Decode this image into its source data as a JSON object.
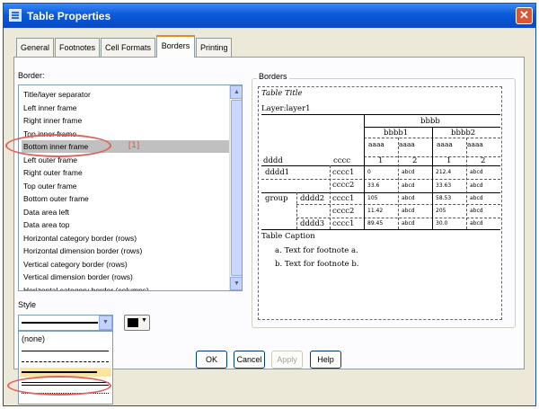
{
  "window": {
    "title": "Table Properties",
    "close_glyph": "✕"
  },
  "tabs": [
    {
      "label": "General",
      "active": false
    },
    {
      "label": "Footnotes",
      "active": false
    },
    {
      "label": "Cell Formats",
      "active": false
    },
    {
      "label": "Borders",
      "active": true
    },
    {
      "label": "Printing",
      "active": false
    }
  ],
  "border_section": {
    "label": "Border:",
    "items": [
      "Title/layer separator",
      "Left inner frame",
      "Right inner frame",
      "Top inner frame",
      "Bottom inner frame",
      "Left outer frame",
      "Right outer frame",
      "Top outer frame",
      "Bottom outer frame",
      "Data area left",
      "Data area top",
      "Horizontal category border (rows)",
      "Horizontal dimension border (rows)",
      "Vertical category border (rows)",
      "Vertical dimension border (rows)",
      "Horizontal category border (columns)"
    ],
    "selected_index": 4,
    "selected_marker": "[1]"
  },
  "style_section": {
    "label": "Style",
    "options": [
      "(none)",
      "thin",
      "dashed",
      "thick",
      "double",
      "dotted"
    ],
    "highlighted_option": "thick",
    "color": "#000000"
  },
  "preview": {
    "group_label": "Borders",
    "table_title": "Table Title",
    "layer": "Layer:layer1",
    "col_top": "bbbb",
    "col_groups": [
      "bbbb1",
      "bbbb2"
    ],
    "col_sub": [
      "aaaa",
      "aaaa",
      "aaaa",
      "aaaa"
    ],
    "col_index": [
      "1",
      "2",
      "1",
      "2"
    ],
    "row_dim": "dddd",
    "row_cat": "cccc",
    "row_d1": "dddd1",
    "row_d2": "dddd2",
    "row_d3": "dddd3",
    "row_group": "group",
    "row_c1": "cccc1",
    "row_c2": "cccc2",
    "cells": [
      [
        "0",
        "abcd",
        "212.4",
        "abcd"
      ],
      [
        "33.6",
        "abcd",
        "33.63",
        "abcd"
      ],
      [
        "105",
        "abcd",
        "58.53",
        "abcd"
      ],
      [
        "11.42",
        "abcd",
        "205",
        "abcd"
      ],
      [
        "89.45",
        "abcd",
        "30.0",
        "abcd"
      ]
    ],
    "caption": "Table Caption",
    "footnotes": [
      "a. Text for footnote a.",
      "b. Text for footnote b."
    ]
  },
  "buttons": {
    "ok": "OK",
    "cancel": "Cancel",
    "apply": "Apply",
    "help": "Help"
  }
}
